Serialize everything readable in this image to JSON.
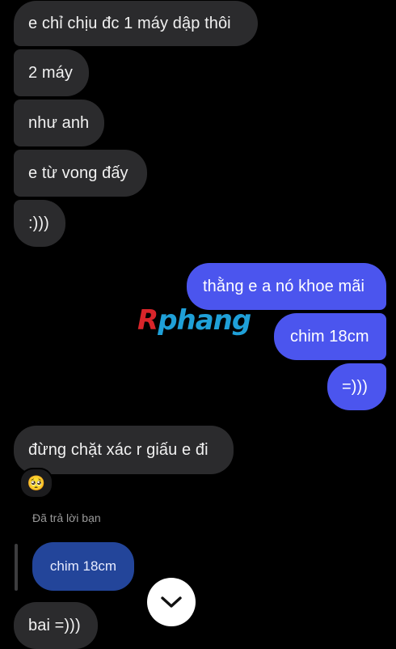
{
  "messages": [
    {
      "text": "e chỉ chịu đc 1 máy dập thôi",
      "direction": "incoming"
    },
    {
      "text": "2 máy",
      "direction": "incoming"
    },
    {
      "text": "như anh",
      "direction": "incoming"
    },
    {
      "text": "e từ vong đấy",
      "direction": "incoming"
    },
    {
      "text": ":)))",
      "direction": "incoming"
    },
    {
      "text": "thằng e a nó khoe mãi",
      "direction": "outgoing"
    },
    {
      "text": "chim 18cm",
      "direction": "outgoing"
    },
    {
      "text": "=)))",
      "direction": "outgoing"
    },
    {
      "text": "đừng chặt xác r giấu e đi",
      "direction": "incoming"
    },
    {
      "text": "bai =)))",
      "direction": "incoming"
    }
  ],
  "reaction": {
    "emoji": "🥺"
  },
  "reply": {
    "label": "Đã trả lời bạn",
    "quoted_text": "chim 18cm"
  },
  "watermark": {
    "first": "R",
    "rest": "phang"
  },
  "colors": {
    "background": "#000000",
    "incoming_bubble": "#2b2b2d",
    "outgoing_bubble": "#4b55ee",
    "quoted_bubble": "#23459a"
  },
  "icons": {
    "scroll_down": "chevron-down-icon"
  }
}
